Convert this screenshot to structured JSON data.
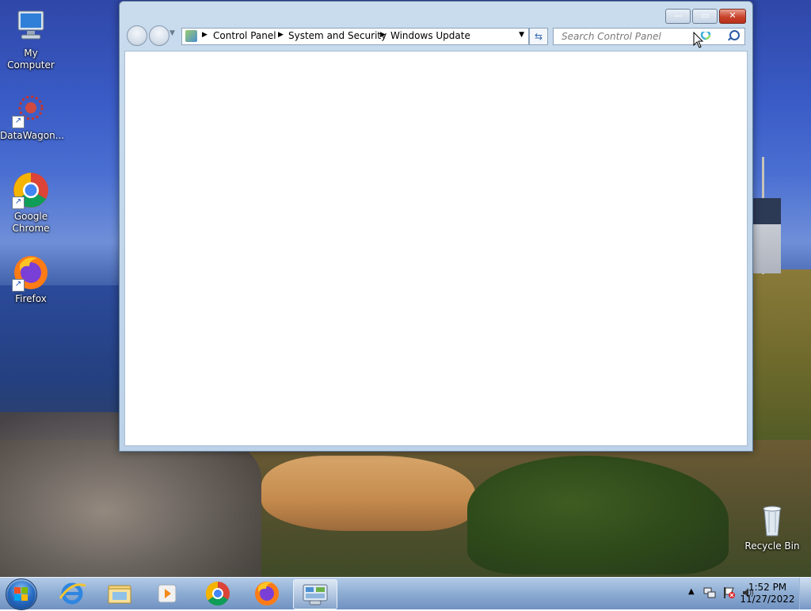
{
  "desktop": {
    "icons": [
      {
        "label": "My Computer"
      },
      {
        "label": "DataWagon..."
      },
      {
        "label": "Google Chrome"
      },
      {
        "label": "Firefox"
      },
      {
        "label": "Recycle Bin"
      }
    ]
  },
  "window": {
    "address": {
      "crumbs": [
        "Control Panel",
        "System and Security",
        "Windows Update"
      ]
    },
    "search": {
      "placeholder": "Search Control Panel"
    }
  },
  "taskbar": {
    "pinned": [
      "Windows Explorer",
      "Internet Explorer",
      "Libraries",
      "Windows Media Player",
      "Google Chrome",
      "Firefox",
      "Control Panel"
    ],
    "clock": {
      "time": "1:52 PM",
      "date": "11/27/2022"
    }
  }
}
